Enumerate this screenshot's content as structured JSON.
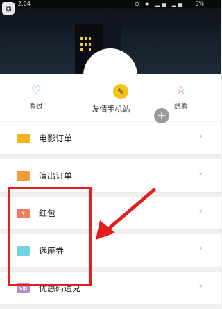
{
  "status_bar": {
    "time": "2:04",
    "battery": "5%",
    "icons": "⊙ ◈ ▂▄ ▂▄"
  },
  "header": {
    "back_icon": "back-square-icon"
  },
  "profile": {
    "username": "友情手机站",
    "badge_icon": "pencil-icon",
    "add_icon": "plus-icon"
  },
  "stats": [
    {
      "label": "看过",
      "icon": "heart-outline-icon",
      "glyph": "♡"
    },
    {
      "label": "想看",
      "icon": "star-outline-icon",
      "glyph": "☆"
    }
  ],
  "menu": [
    {
      "label": "电影订单",
      "icon": "ticket-icon",
      "icon_text": ""
    },
    {
      "label": "演出订单",
      "icon": "ticket-icon",
      "icon_text": ""
    },
    {
      "label": "红包",
      "icon": "red-envelope-icon",
      "icon_text": "¥"
    },
    {
      "label": "选座券",
      "icon": "seat-coupon-icon",
      "icon_text": ""
    },
    {
      "label": "优惠码通兑",
      "icon": "vip-icon",
      "icon_text": "vip"
    }
  ],
  "colors": {
    "highlight": "#e11f1f",
    "badge": "#f5c21a"
  }
}
